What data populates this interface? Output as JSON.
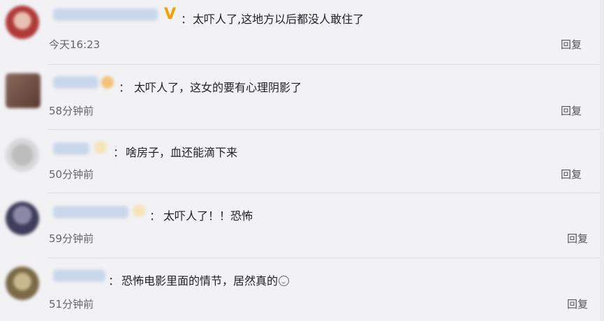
{
  "comments": [
    {
      "badge_type": "v",
      "badge_label": "V",
      "colon": "：",
      "text": "太吓人了,这地方以后都没人敢住了",
      "time": "今天16:23",
      "reply": "回复",
      "avatar_color": "#b03a3a"
    },
    {
      "badge_type": "gold",
      "colon": "：",
      "text": "太吓人了，这女的要有心理阴影了",
      "time": "58分钟前",
      "reply": "回复",
      "avatar_color": "#7a5a4c"
    },
    {
      "badge_type": "light",
      "colon": "：",
      "text": "啥房子，血还能滴下来",
      "time": "50分钟前",
      "reply": "回复",
      "avatar_color": "#9a9a9a"
    },
    {
      "badge_type": "light",
      "colon": "：",
      "text": "太吓人了！！恐怖",
      "time": "59分钟前",
      "reply": "回复",
      "avatar_color": "#4a4a6a"
    },
    {
      "badge_type": "none",
      "colon": "：",
      "text": "恐怖电影里面的情节，居然真的",
      "emoji": "smile-emoji",
      "time": "51分钟前",
      "reply": "回复",
      "avatar_color": "#8a7a55"
    }
  ],
  "colors": {
    "background": "#f2f2f5",
    "divider": "#dcdce2",
    "verified_badge": "#f4a100",
    "blurred_name": "#c9d7ea"
  }
}
